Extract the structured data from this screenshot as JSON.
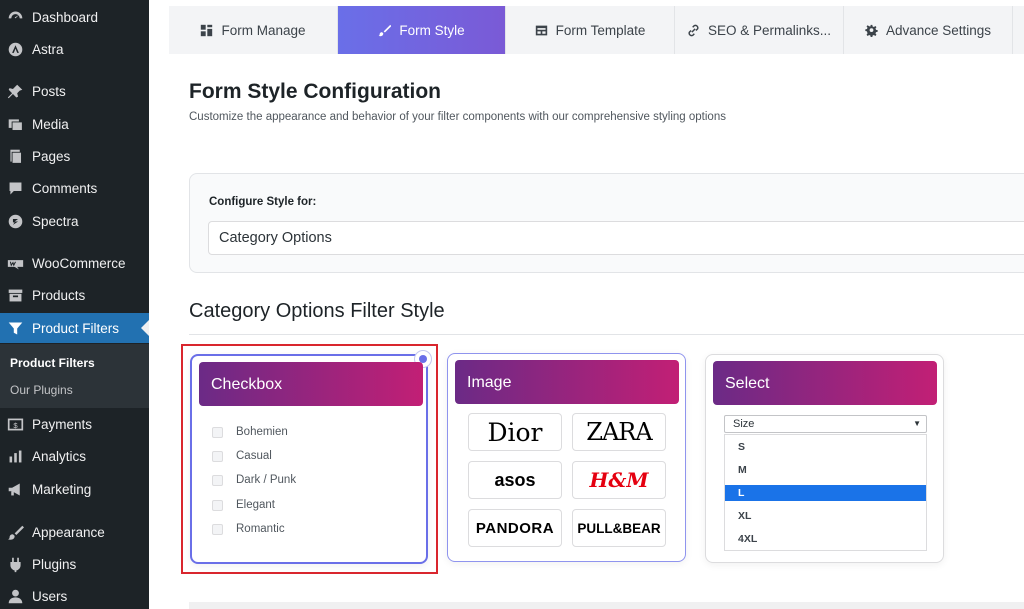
{
  "sidebar": {
    "items": [
      {
        "label": "Dashboard",
        "icon": "dashboard-icon"
      },
      {
        "label": "Astra",
        "icon": "astra-icon"
      },
      {
        "label": "Posts",
        "icon": "pin-icon"
      },
      {
        "label": "Media",
        "icon": "media-icon"
      },
      {
        "label": "Pages",
        "icon": "pages-icon"
      },
      {
        "label": "Comments",
        "icon": "comment-icon"
      },
      {
        "label": "Spectra",
        "icon": "spectra-icon"
      },
      {
        "label": "WooCommerce",
        "icon": "woocommerce-icon"
      },
      {
        "label": "Products",
        "icon": "archive-icon"
      },
      {
        "label": "Product Filters",
        "icon": "filter-icon"
      },
      {
        "label": "Payments",
        "icon": "payments-icon"
      },
      {
        "label": "Analytics",
        "icon": "chart-bar-icon"
      },
      {
        "label": "Marketing",
        "icon": "megaphone-icon"
      },
      {
        "label": "Appearance",
        "icon": "brush-icon"
      },
      {
        "label": "Plugins",
        "icon": "plug-icon"
      },
      {
        "label": "Users",
        "icon": "user-icon"
      }
    ],
    "submenu": [
      "Product Filters",
      "Our Plugins"
    ]
  },
  "tabs": [
    {
      "label": "Form Manage",
      "icon": "grid-icon"
    },
    {
      "label": "Form Style",
      "icon": "brush-icon"
    },
    {
      "label": "Form Template",
      "icon": "template-icon"
    },
    {
      "label": "SEO & Permalinks...",
      "icon": "link-icon"
    },
    {
      "label": "Advance Settings",
      "icon": "gear-icon"
    }
  ],
  "page": {
    "title": "Form Style Configuration",
    "subtitle": "Customize the appearance and behavior of your filter components with our comprehensive styling options"
  },
  "config": {
    "label": "Configure Style for:",
    "selected": "Category Options"
  },
  "section_title": "Category Options Filter Style",
  "styles": {
    "checkbox": {
      "title": "Checkbox",
      "options": [
        "Bohemien",
        "Casual",
        "Dark / Punk",
        "Elegant",
        "Romantic"
      ]
    },
    "image": {
      "title": "Image",
      "brands": [
        "Dior",
        "ZARA",
        "asos",
        "H&M",
        "PANDORA",
        "PULL&BEAR"
      ]
    },
    "select": {
      "title": "Select",
      "placeholder": "Size",
      "options": [
        "S",
        "M",
        "L",
        "XL",
        "4XL"
      ],
      "highlighted": "L"
    }
  },
  "colors": {
    "active_menu": "#2271b1",
    "tab_gradient_start": "#6a6fe8",
    "header_gradient_start": "#6b2a86",
    "header_gradient_end": "#c21f75",
    "selection_frame": "#d9262e"
  }
}
